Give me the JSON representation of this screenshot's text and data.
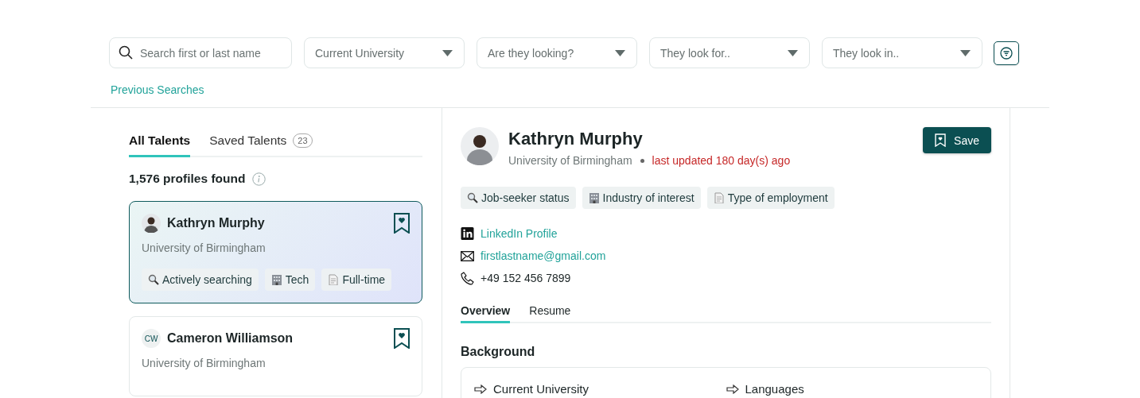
{
  "filters": {
    "search": {
      "placeholder": "Search first or last name"
    },
    "dropdowns": [
      {
        "placeholder": "Current University"
      },
      {
        "placeholder": "Are they looking?"
      },
      {
        "placeholder": "They look for.."
      },
      {
        "placeholder": "They look in.."
      }
    ],
    "previous_searches": "Previous Searches"
  },
  "list_tabs": [
    {
      "label": "All Talents",
      "selected": true
    },
    {
      "label": "Saved Talents",
      "count": "23",
      "selected": false
    }
  ],
  "profiles_found": "1,576 profiles found",
  "profiles": [
    {
      "name": "Kathryn Murphy",
      "university": "University of Birmingham",
      "selected": true,
      "tags": [
        {
          "kind": "status",
          "label": "Actively searching"
        },
        {
          "kind": "industry",
          "label": "Tech"
        },
        {
          "kind": "employment",
          "label": "Full-time"
        }
      ]
    },
    {
      "name": "Cameron Williamson",
      "initials": "CW",
      "university": "University of Birmingham",
      "selected": false
    }
  ],
  "detail": {
    "name": "Kathryn Murphy",
    "university": "University of Birmingham",
    "updated": "last updated 180 day(s) ago",
    "save": "Save",
    "tags": [
      {
        "kind": "status",
        "label": "Job-seeker status"
      },
      {
        "kind": "industry",
        "label": "Industry of interest"
      },
      {
        "kind": "employment",
        "label": "Type of employment"
      }
    ],
    "contacts": [
      {
        "kind": "linkedin",
        "text": "LinkedIn Profile"
      },
      {
        "kind": "email",
        "text": "firstlastname@gmail.com"
      },
      {
        "kind": "phone",
        "text": "+49 152 456 7899"
      }
    ],
    "tabs": [
      {
        "label": "Overview",
        "selected": true
      },
      {
        "label": "Resume",
        "selected": false
      }
    ],
    "section_title": "Background",
    "background_fields": [
      "Current University",
      "Languages"
    ]
  }
}
